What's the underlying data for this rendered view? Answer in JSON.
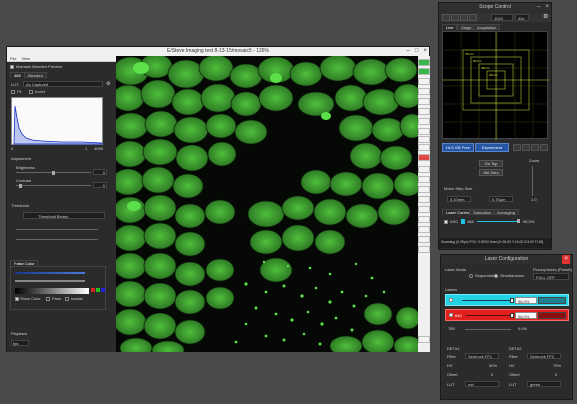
{
  "main_window": {
    "title": "E/Steve Imaging test 8-13-15/mosaic5 - 126%",
    "menu": [
      "File",
      "View"
    ],
    "left_panel": {
      "maintain_blended_preview": "Maintain Blended Preview",
      "tabs": [
        "488",
        "Blended"
      ],
      "lut_label": "LUT:",
      "lut_value": "As Captured",
      "checkbox_fit": "Fit",
      "checkbox_invert": "Invert",
      "histogram_min": "0",
      "histogram_max": "1",
      "histogram_right": "4095",
      "adjustment_header": "Adjustment",
      "brightness_label": "Brightness",
      "brightness_value": "0",
      "contrast_label": "Contrast",
      "contrast_value": "0",
      "threshold_header": "Threshold",
      "threshold_select": "Threshold Binary",
      "false_color_tab": "False Color",
      "show_color": "Show Color",
      "pass_label": "Pass",
      "isolate_label": "Isolate",
      "playback_header": "Playback",
      "fps_value": "fps"
    }
  },
  "scope_control": {
    "title": "Scope Control",
    "zoom_value": "1024",
    "mag_value": "40x",
    "tabs": [
      "Live",
      "Stage",
      "Acquisition"
    ],
    "fov_labels": [
      "75mm",
      "60mm",
      "45mm",
      "30mm"
    ],
    "hls_button": "HLS GB Free",
    "experiment_button": "Experiment",
    "go_top": "Go Top",
    "set_zero": "Set Zero",
    "zoom_label": "Zoom",
    "motor_step_label": "Motor Step Size",
    "step_left": "0.10mm",
    "step_right": "0.70μm",
    "zoom_value_right": "1.0",
    "tabs2": [
      "Laser Control",
      "Saturation",
      "Averaging"
    ],
    "laser_value": "488",
    "laser_pct": "98.0%",
    "status": "Scanning (0.09px) FOV: 0.59X0.5mm [X:25.00 Y:18.00 Z:5.00 Ti:15]"
  },
  "laser_config": {
    "title": "Laser Configuration",
    "laser_mode_label": "Laser Mode",
    "mode_sequential": "Sequential",
    "mode_simultaneous": "Simultaneous",
    "fluorophore_label": "Fluorophores (Preset)",
    "fluorophore_value": "FULL GFP",
    "lasers_header": "Lasers",
    "laser1_pct": "98.0%",
    "laser2_pct": "98.0%",
    "laser3_pct": "0.0%",
    "laser3_label": "785",
    "det1_header": "DET#1",
    "det2_header": "DET#2",
    "filter_label": "Filter",
    "det1_filter": "Semrock FF1",
    "det2_filter": "Semrock FF2",
    "hv_label": "HV",
    "det1_hv": "50%",
    "det2_hv": "75%",
    "offset_label": "Offset",
    "det1_offset": "0",
    "det2_offset": "0",
    "lut_label": "LUT",
    "det1_lut": "red",
    "det2_lut": "green"
  },
  "colors": {
    "cyan_laser": "#22d3e6",
    "red_laser": "#e0201c",
    "image_green": "#3aa92f"
  }
}
